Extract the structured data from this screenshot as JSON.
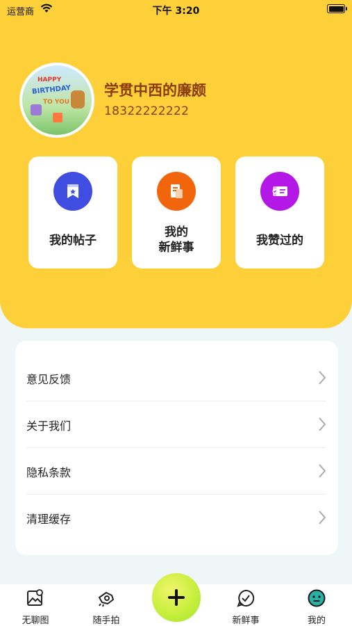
{
  "status_bar": {
    "carrier": "运营商",
    "time": "下午 3:20"
  },
  "profile": {
    "avatar_text": [
      "HAPPY",
      "BIRTHDAY",
      "TO YOU"
    ],
    "username": "学贯中西的廉颇",
    "phone": "18322222222"
  },
  "quick_actions": [
    {
      "label": [
        "我的帖子"
      ],
      "icon": "bookmark-star-icon",
      "color": "#3f4ee0"
    },
    {
      "label": [
        "我的",
        "新鲜事"
      ],
      "icon": "document-icon",
      "color": "#f1650c"
    },
    {
      "label": [
        "我赞过的"
      ],
      "icon": "id-card-icon",
      "color": "#b418e6"
    }
  ],
  "menu": [
    {
      "label": "意见反馈"
    },
    {
      "label": "关于我们"
    },
    {
      "label": "隐私条款"
    },
    {
      "label": "清理缓存"
    }
  ],
  "tabbar": [
    {
      "label": "无聊图",
      "icon": "picture-icon"
    },
    {
      "label": "随手拍",
      "icon": "camera-hand-icon"
    },
    {
      "label": "",
      "icon": "plus-icon"
    },
    {
      "label": "新鲜事",
      "icon": "chat-check-icon"
    },
    {
      "label": "我的",
      "icon": "smiley-icon",
      "active": true
    }
  ],
  "colors": {
    "hero": "#fdd03a",
    "username": "#8a3b07",
    "fab": "#c8ef3e",
    "active_tab": "#2bb0a6"
  }
}
